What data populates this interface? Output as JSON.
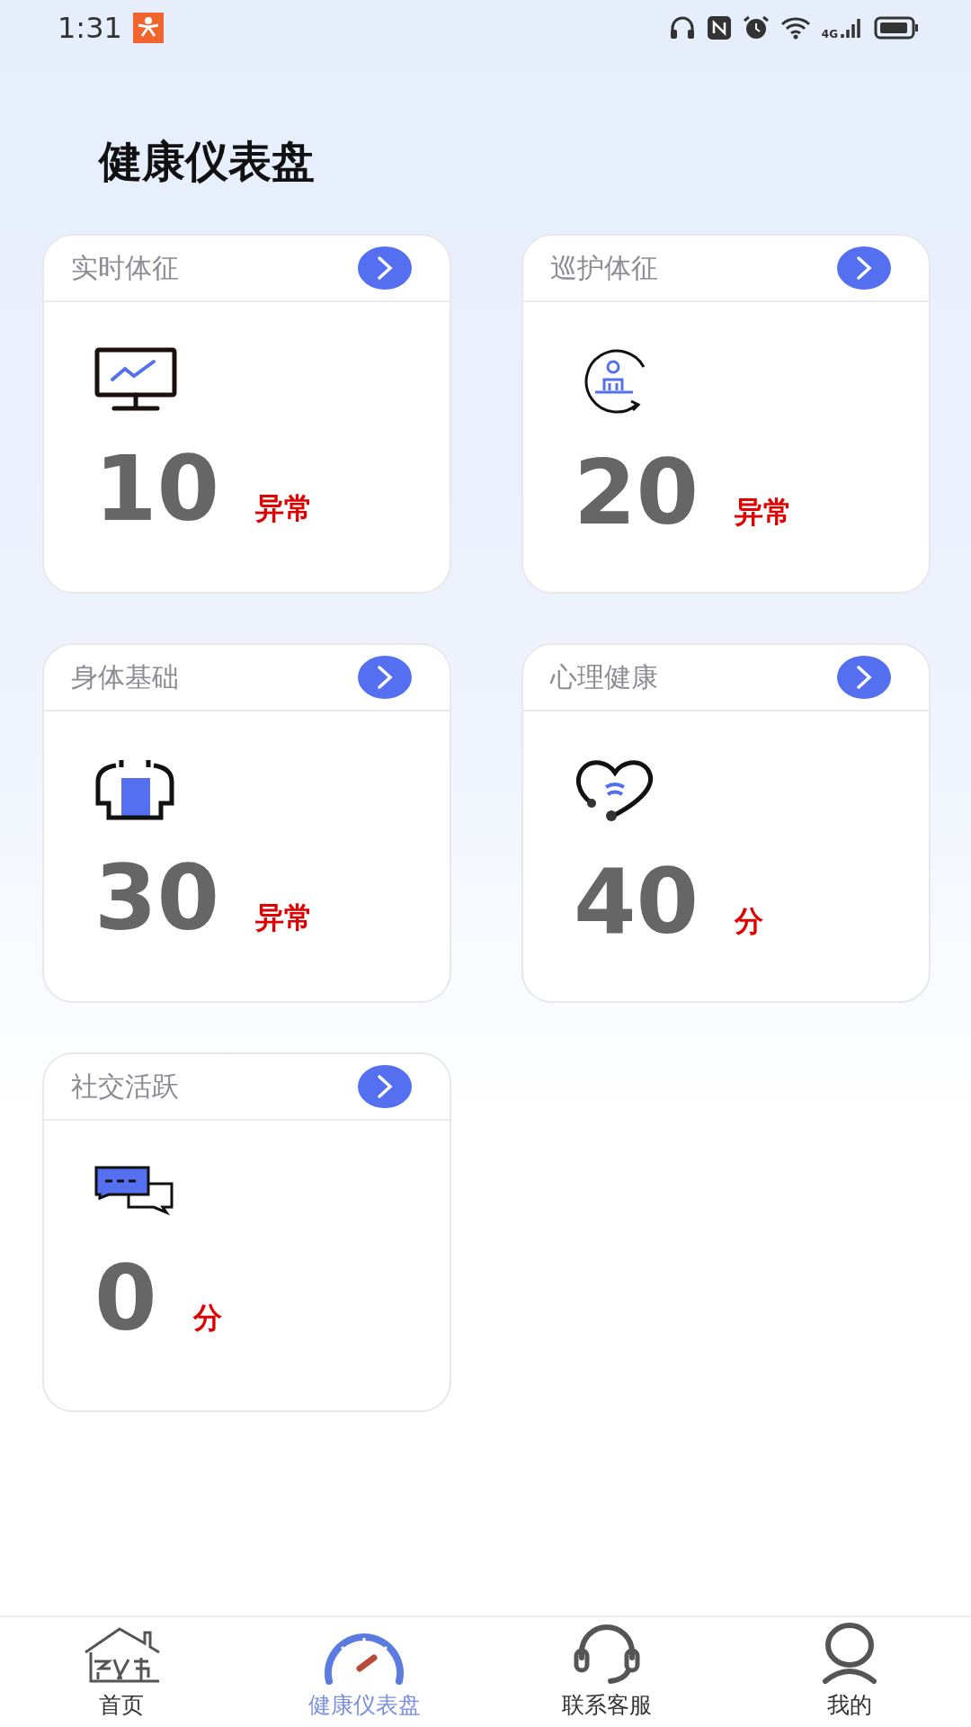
{
  "status_bar": {
    "time": "1:31",
    "network": "4G"
  },
  "title": "健康仪表盘",
  "cards": [
    {
      "title": "实时体征",
      "kind": "monitor",
      "value": "10",
      "unit": "异常"
    },
    {
      "title": "巡护体征",
      "kind": "patrol",
      "value": "20",
      "unit": "异常"
    },
    {
      "title": "身体基础",
      "kind": "body",
      "value": "30",
      "unit": "异常"
    },
    {
      "title": "心理健康",
      "kind": "heart",
      "value": "40",
      "unit": "分"
    },
    {
      "title": "社交活跃",
      "kind": "chat",
      "value": "0",
      "unit": "分"
    }
  ],
  "nav": [
    {
      "label": "首页",
      "kind": "home",
      "selected": false
    },
    {
      "label": "健康仪表盘",
      "kind": "gauge",
      "selected": true
    },
    {
      "label": "联系客服",
      "kind": "headset",
      "selected": false
    },
    {
      "label": "我的",
      "kind": "user",
      "selected": false
    }
  ]
}
